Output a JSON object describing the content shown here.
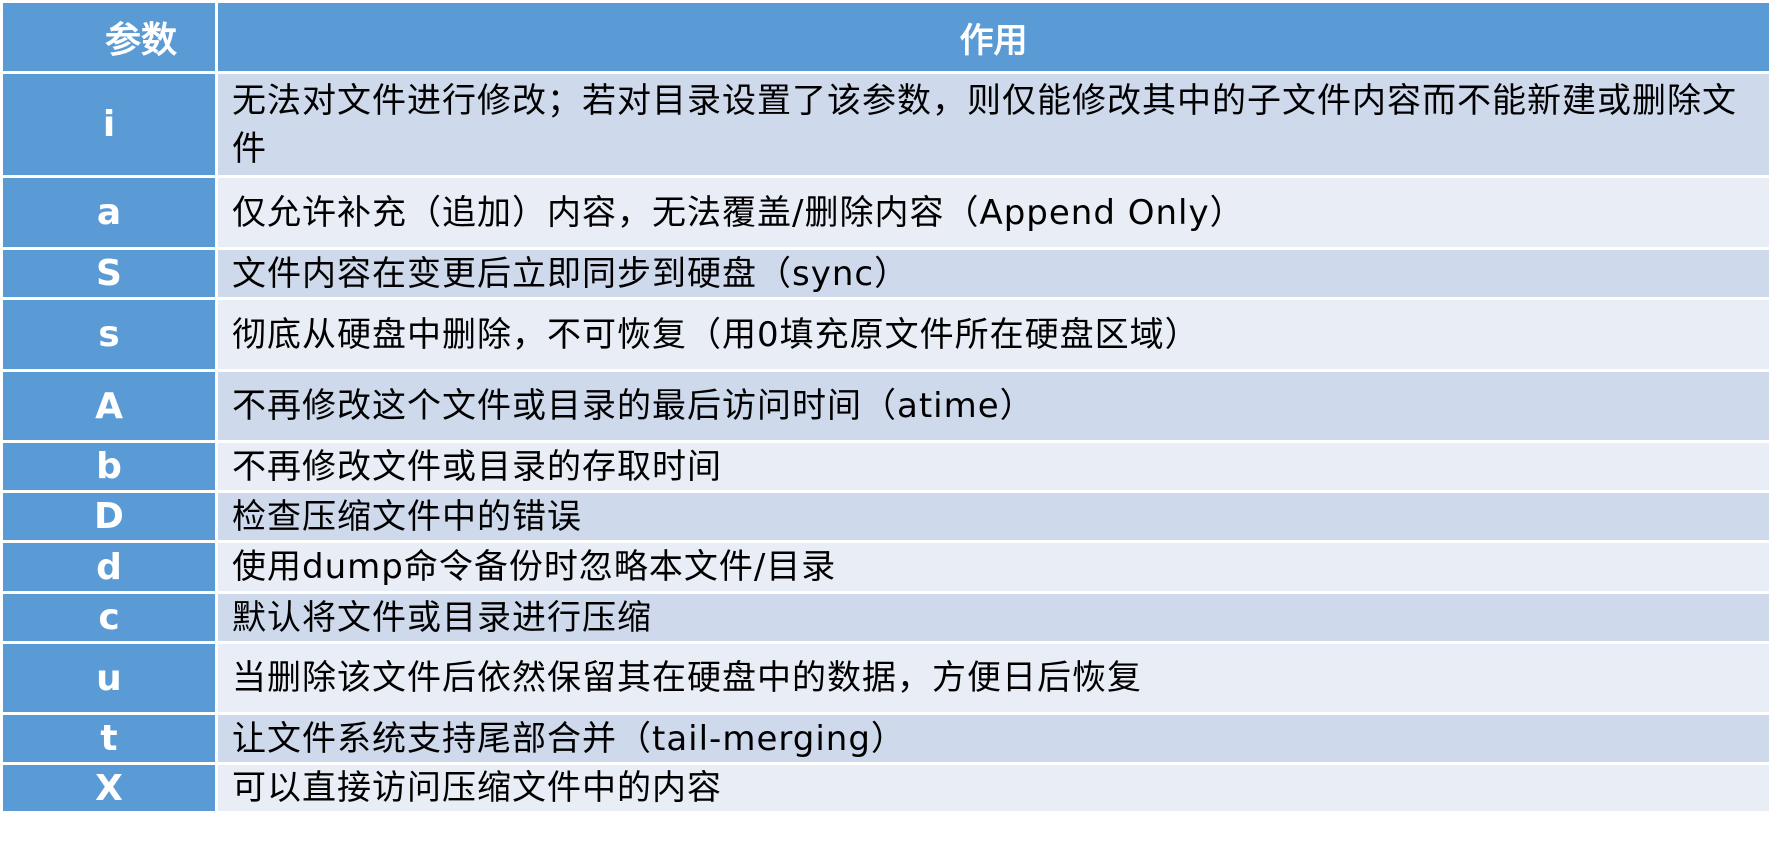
{
  "header": {
    "param": "参数",
    "effect": "作用"
  },
  "rows": [
    {
      "param": "i",
      "desc": "无法对文件进行修改；若对目录设置了该参数，则仅能修改其中的子文件内容而不能新建或删除文件"
    },
    {
      "param": "a",
      "desc": "仅允许补充（追加）内容，无法覆盖/删除内容（Append Only）"
    },
    {
      "param": "S",
      "desc": "文件内容在变更后立即同步到硬盘（sync）"
    },
    {
      "param": "s",
      "desc": "彻底从硬盘中删除，不可恢复（用0填充原文件所在硬盘区域）"
    },
    {
      "param": "A",
      "desc": "不再修改这个文件或目录的最后访问时间（atime）"
    },
    {
      "param": "b",
      "desc": "不再修改文件或目录的存取时间"
    },
    {
      "param": "D",
      "desc": "检查压缩文件中的错误"
    },
    {
      "param": "d",
      "desc": "使用dump命令备份时忽略本文件/目录"
    },
    {
      "param": "c",
      "desc": "默认将文件或目录进行压缩"
    },
    {
      "param": "u",
      "desc": "当删除该文件后依然保留其在硬盘中的数据，方便日后恢复"
    },
    {
      "param": "t",
      "desc": "让文件系统支持尾部合并（tail-merging）"
    },
    {
      "param": "X",
      "desc": "可以直接访问压缩文件中的内容"
    }
  ],
  "colors": {
    "header": "#5b9bd5",
    "row_dark": "#cfd9ec",
    "row_light": "#e9edf6"
  }
}
